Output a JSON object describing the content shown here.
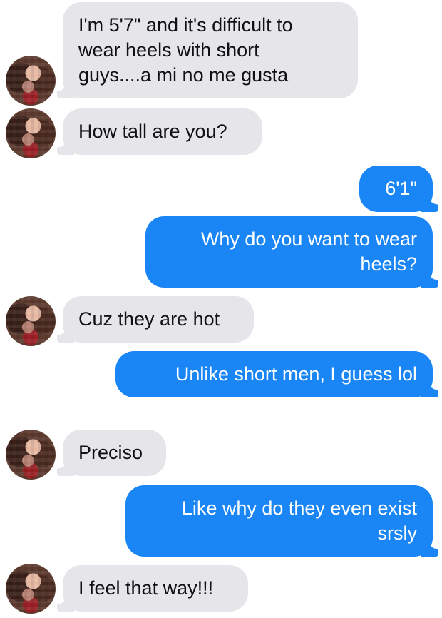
{
  "conversation": {
    "messages": [
      {
        "direction": "in",
        "lines": [
          "I'm 5'7\" and it's difficult to",
          "wear heels with short",
          "guys....a mi no me gusta"
        ]
      },
      {
        "direction": "in",
        "lines": [
          "How tall are you?"
        ]
      },
      {
        "direction": "out",
        "lines": [
          "6'1\""
        ]
      },
      {
        "direction": "out",
        "lines": [
          "Why do you want to wear",
          "heels?"
        ]
      },
      {
        "direction": "in",
        "lines": [
          "Cuz they are hot"
        ]
      },
      {
        "direction": "out",
        "lines": [
          "Unlike short men, I guess lol"
        ]
      },
      {
        "direction": "in",
        "lines": [
          "Preciso"
        ]
      },
      {
        "direction": "out",
        "lines": [
          "Like why do they even exist",
          "srsly"
        ]
      },
      {
        "direction": "in",
        "lines": [
          "I feel that way!!!"
        ]
      }
    ]
  },
  "colors": {
    "incoming_bubble": "#e5e5ea",
    "outgoing_bubble": "#1a86f5",
    "incoming_text": "#111111",
    "outgoing_text": "#ffffff"
  },
  "icons": {
    "sender_avatar": "avatar-icon"
  }
}
